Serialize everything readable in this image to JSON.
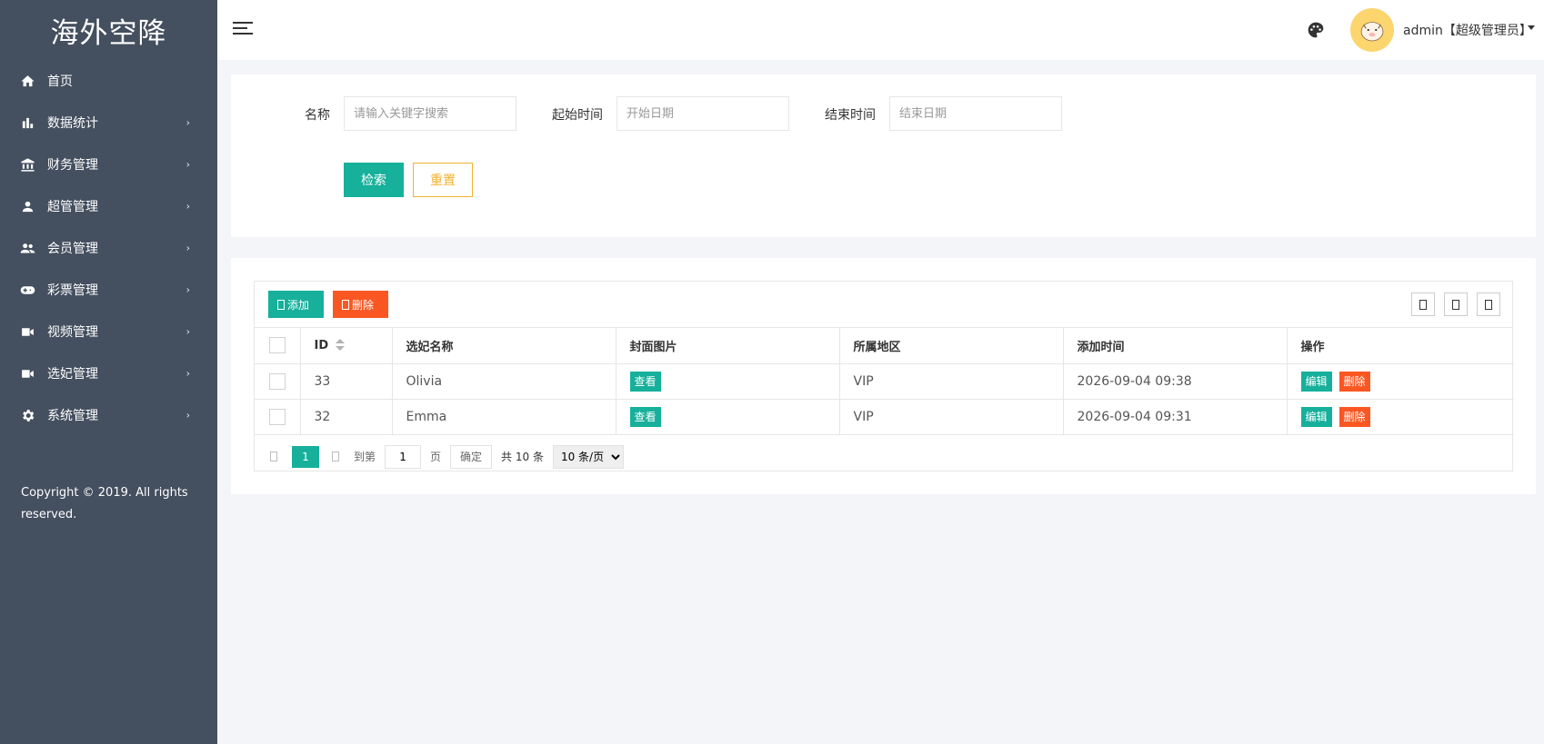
{
  "sidebar": {
    "logo": "海外空降",
    "items": [
      {
        "label": "首页",
        "icon": "home-icon",
        "has_arrow": false
      },
      {
        "label": "数据统计",
        "icon": "bar-chart-icon",
        "has_arrow": true
      },
      {
        "label": "财务管理",
        "icon": "bank-icon",
        "has_arrow": true
      },
      {
        "label": "超管管理",
        "icon": "user-icon",
        "has_arrow": true
      },
      {
        "label": "会员管理",
        "icon": "users-icon",
        "has_arrow": true
      },
      {
        "label": "彩票管理",
        "icon": "gamepad-icon",
        "has_arrow": true
      },
      {
        "label": "视频管理",
        "icon": "video-icon",
        "has_arrow": true
      },
      {
        "label": "选妃管理",
        "icon": "video-icon",
        "has_arrow": true
      },
      {
        "label": "系统管理",
        "icon": "gear-icon",
        "has_arrow": true
      }
    ],
    "arrow": "›",
    "copyright": "Copyright © 2019. All rights reserved."
  },
  "header": {
    "user_name": "admin【超级管理员】"
  },
  "search": {
    "name_label": "名称",
    "name_placeholder": "请输入关键字搜索",
    "start_label": "起始时间",
    "start_placeholder": "开始日期",
    "end_label": "结束时间",
    "end_placeholder": "结束日期",
    "search_btn": "检索",
    "reset_btn": "重置"
  },
  "toolbar": {
    "add_label": "添加",
    "delete_label": "删除"
  },
  "table": {
    "columns": [
      "ID",
      "选妃名称",
      "封面图片",
      "所属地区",
      "添加时间",
      "操作"
    ],
    "rows": [
      {
        "id": "33",
        "name": "Olivia",
        "cover": "查看",
        "region": "VIP",
        "time": "2026-09-04 09:38",
        "edit": "编辑",
        "delete": "删除"
      },
      {
        "id": "32",
        "name": "Emma",
        "cover": "查看",
        "region": "VIP",
        "time": "2026-09-04 09:31",
        "edit": "编辑",
        "delete": "删除"
      }
    ]
  },
  "pager": {
    "current": "1",
    "goto_label": "到第",
    "goto_value": "1",
    "page_unit": "页",
    "ok_label": "确定",
    "total": "共 10 条",
    "page_size": "10 条/页"
  },
  "colors": {
    "sidebar_bg": "#444f5f",
    "primary": "#16b09b",
    "danger": "#fb5722",
    "warning": "#f3b22f"
  }
}
